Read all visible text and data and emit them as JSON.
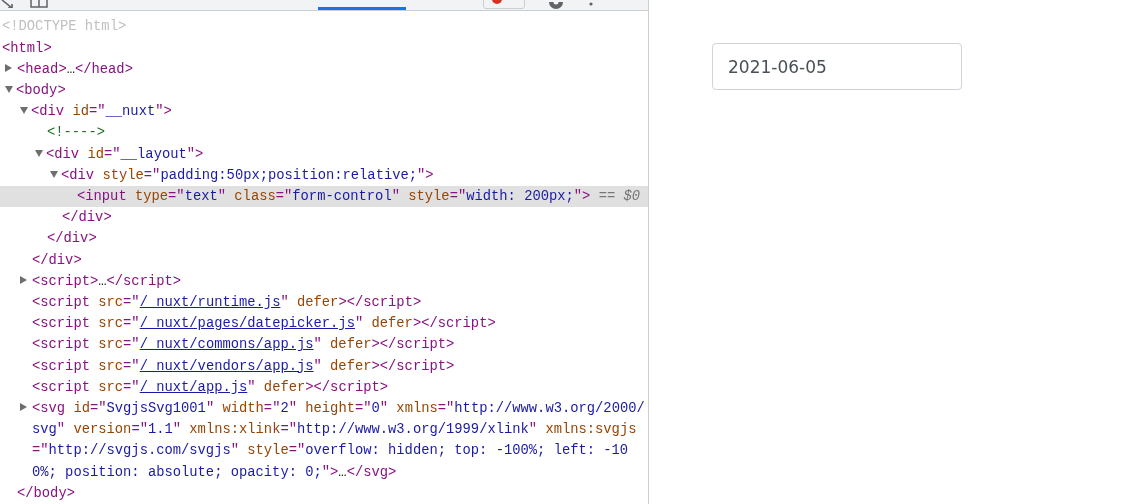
{
  "devtools": {
    "tabs": [
      {
        "selected": false
      },
      {
        "selected": false
      },
      {
        "selected": false
      },
      {
        "selected": true
      }
    ],
    "dom_tree": [
      {
        "tokens": [
          {
            "kind": "doctype",
            "text": "<!DOCTYPE html>"
          }
        ],
        "selected": false
      },
      {
        "tokens": [
          {
            "kind": "tag",
            "text": "<html>"
          }
        ],
        "selected": false,
        "children": [
          {
            "tokens": [
              {
                "kind": "tag",
                "text": "<head>"
              },
              {
                "kind": "text",
                "text": "…"
              },
              {
                "kind": "tag",
                "text": "</head>"
              }
            ],
            "expanded": false,
            "selected": false
          },
          {
            "tokens": [
              {
                "kind": "tag",
                "text": "<body>"
              }
            ],
            "expanded": true,
            "selected": false,
            "children": [
              {
                "tokens": [
                  {
                    "kind": "tag",
                    "text": "<div "
                  },
                  {
                    "kind": "attr",
                    "text": "id"
                  },
                  {
                    "kind": "tag",
                    "text": "=\""
                  },
                  {
                    "kind": "val",
                    "text": "__nuxt"
                  },
                  {
                    "kind": "tag",
                    "text": "\">"
                  }
                ],
                "expanded": true,
                "selected": false,
                "children": [
                  {
                    "tokens": [
                      {
                        "kind": "comment",
                        "text": "<!---->"
                      }
                    ],
                    "selected": false
                  },
                  {
                    "tokens": [
                      {
                        "kind": "tag",
                        "text": "<div "
                      },
                      {
                        "kind": "attr",
                        "text": "id"
                      },
                      {
                        "kind": "tag",
                        "text": "=\""
                      },
                      {
                        "kind": "val",
                        "text": "__layout"
                      },
                      {
                        "kind": "tag",
                        "text": "\">"
                      }
                    ],
                    "expanded": true,
                    "selected": false,
                    "children": [
                      {
                        "tokens": [
                          {
                            "kind": "tag",
                            "text": "<div "
                          },
                          {
                            "kind": "attr",
                            "text": "style"
                          },
                          {
                            "kind": "tag",
                            "text": "=\""
                          },
                          {
                            "kind": "val",
                            "text": "padding:50px;position:relative;"
                          },
                          {
                            "kind": "tag",
                            "text": "\">"
                          }
                        ],
                        "expanded": true,
                        "selected": false,
                        "children": [
                          {
                            "tokens": [
                              {
                                "kind": "tag",
                                "text": "<input "
                              },
                              {
                                "kind": "attr",
                                "text": "type"
                              },
                              {
                                "kind": "tag",
                                "text": "=\""
                              },
                              {
                                "kind": "val",
                                "text": "text"
                              },
                              {
                                "kind": "tag",
                                "text": "\" "
                              },
                              {
                                "kind": "attr",
                                "text": "class"
                              },
                              {
                                "kind": "tag",
                                "text": "=\""
                              },
                              {
                                "kind": "val",
                                "text": "form-control"
                              },
                              {
                                "kind": "tag",
                                "text": "\" "
                              },
                              {
                                "kind": "attr",
                                "text": "style"
                              },
                              {
                                "kind": "tag",
                                "text": "=\""
                              },
                              {
                                "kind": "val",
                                "text": "width: 200px;"
                              },
                              {
                                "kind": "tag",
                                "text": "\">"
                              },
                              {
                                "kind": "note",
                                "text": " == $0"
                              }
                            ],
                            "selected": true
                          }
                        ],
                        "close": [
                          {
                            "kind": "tag",
                            "text": "</div>"
                          }
                        ]
                      }
                    ],
                    "close": [
                      {
                        "kind": "tag",
                        "text": "</div>"
                      }
                    ]
                  }
                ],
                "close": [
                  {
                    "kind": "tag",
                    "text": "</div>"
                  }
                ]
              },
              {
                "tokens": [
                  {
                    "kind": "tag",
                    "text": "<script>"
                  },
                  {
                    "kind": "text",
                    "text": "…"
                  },
                  {
                    "kind": "tag",
                    "text": "</script>"
                  }
                ],
                "expanded": false,
                "selected": false
              },
              {
                "tokens": [
                  {
                    "kind": "tag",
                    "text": "<script "
                  },
                  {
                    "kind": "attr",
                    "text": "src"
                  },
                  {
                    "kind": "tag",
                    "text": "=\""
                  },
                  {
                    "kind": "link",
                    "text": "/_nuxt/runtime.js"
                  },
                  {
                    "kind": "tag",
                    "text": "\" "
                  },
                  {
                    "kind": "attr",
                    "text": "defer"
                  },
                  {
                    "kind": "tag",
                    "text": "></script>"
                  }
                ],
                "selected": false
              },
              {
                "tokens": [
                  {
                    "kind": "tag",
                    "text": "<script "
                  },
                  {
                    "kind": "attr",
                    "text": "src"
                  },
                  {
                    "kind": "tag",
                    "text": "=\""
                  },
                  {
                    "kind": "link",
                    "text": "/_nuxt/pages/datepicker.js"
                  },
                  {
                    "kind": "tag",
                    "text": "\" "
                  },
                  {
                    "kind": "attr",
                    "text": "defer"
                  },
                  {
                    "kind": "tag",
                    "text": "></script>"
                  }
                ],
                "selected": false
              },
              {
                "tokens": [
                  {
                    "kind": "tag",
                    "text": "<script "
                  },
                  {
                    "kind": "attr",
                    "text": "src"
                  },
                  {
                    "kind": "tag",
                    "text": "=\""
                  },
                  {
                    "kind": "link",
                    "text": "/_nuxt/commons/app.js"
                  },
                  {
                    "kind": "tag",
                    "text": "\" "
                  },
                  {
                    "kind": "attr",
                    "text": "defer"
                  },
                  {
                    "kind": "tag",
                    "text": "></script>"
                  }
                ],
                "selected": false
              },
              {
                "tokens": [
                  {
                    "kind": "tag",
                    "text": "<script "
                  },
                  {
                    "kind": "attr",
                    "text": "src"
                  },
                  {
                    "kind": "tag",
                    "text": "=\""
                  },
                  {
                    "kind": "link",
                    "text": "/_nuxt/vendors/app.js"
                  },
                  {
                    "kind": "tag",
                    "text": "\" "
                  },
                  {
                    "kind": "attr",
                    "text": "defer"
                  },
                  {
                    "kind": "tag",
                    "text": "></script>"
                  }
                ],
                "selected": false
              },
              {
                "tokens": [
                  {
                    "kind": "tag",
                    "text": "<script "
                  },
                  {
                    "kind": "attr",
                    "text": "src"
                  },
                  {
                    "kind": "tag",
                    "text": "=\""
                  },
                  {
                    "kind": "link",
                    "text": "/_nuxt/app.js"
                  },
                  {
                    "kind": "tag",
                    "text": "\" "
                  },
                  {
                    "kind": "attr",
                    "text": "defer"
                  },
                  {
                    "kind": "tag",
                    "text": "></script>"
                  }
                ],
                "selected": false
              },
              {
                "tokens": [
                  {
                    "kind": "tag",
                    "text": "<svg "
                  },
                  {
                    "kind": "attr",
                    "text": "id"
                  },
                  {
                    "kind": "tag",
                    "text": "=\""
                  },
                  {
                    "kind": "val",
                    "text": "SvgjsSvg1001"
                  },
                  {
                    "kind": "tag",
                    "text": "\" "
                  },
                  {
                    "kind": "attr",
                    "text": "width"
                  },
                  {
                    "kind": "tag",
                    "text": "=\""
                  },
                  {
                    "kind": "val",
                    "text": "2"
                  },
                  {
                    "kind": "tag",
                    "text": "\" "
                  },
                  {
                    "kind": "attr",
                    "text": "height"
                  },
                  {
                    "kind": "tag",
                    "text": "=\""
                  },
                  {
                    "kind": "val",
                    "text": "0"
                  },
                  {
                    "kind": "tag",
                    "text": "\" "
                  },
                  {
                    "kind": "attr",
                    "text": "xmlns"
                  },
                  {
                    "kind": "tag",
                    "text": "=\""
                  },
                  {
                    "kind": "val",
                    "text": "http://www.w3.org/2000/svg"
                  },
                  {
                    "kind": "tag",
                    "text": "\" "
                  },
                  {
                    "kind": "attr",
                    "text": "version"
                  },
                  {
                    "kind": "tag",
                    "text": "=\""
                  },
                  {
                    "kind": "val",
                    "text": "1.1"
                  },
                  {
                    "kind": "tag",
                    "text": "\" "
                  },
                  {
                    "kind": "attr",
                    "text": "xmlns:xlink"
                  },
                  {
                    "kind": "tag",
                    "text": "=\""
                  },
                  {
                    "kind": "val",
                    "text": "http://www.w3.org/1999/xlink"
                  },
                  {
                    "kind": "tag",
                    "text": "\" "
                  },
                  {
                    "kind": "attr",
                    "text": "xmlns:svgjs"
                  },
                  {
                    "kind": "tag",
                    "text": "=\""
                  },
                  {
                    "kind": "val",
                    "text": "http://svgjs.com/svgjs"
                  },
                  {
                    "kind": "tag",
                    "text": "\" "
                  },
                  {
                    "kind": "attr",
                    "text": "style"
                  },
                  {
                    "kind": "tag",
                    "text": "=\""
                  },
                  {
                    "kind": "val",
                    "text": "overflow: hidden; top: -100%; left: -100%; position: absolute; opacity: 0;"
                  },
                  {
                    "kind": "tag",
                    "text": "\">"
                  },
                  {
                    "kind": "text",
                    "text": "…"
                  },
                  {
                    "kind": "tag",
                    "text": "</svg>"
                  }
                ],
                "expanded": false,
                "selected": false
              }
            ],
            "close": [
              {
                "kind": "tag",
                "text": "</body>"
              }
            ]
          }
        ]
      }
    ]
  },
  "page": {
    "date_input": {
      "value": "2021-06-05"
    }
  }
}
